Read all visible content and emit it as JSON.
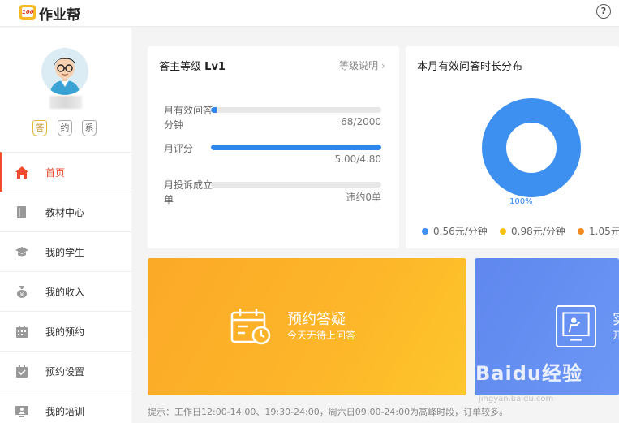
{
  "app": {
    "logo_text": "100",
    "title": "作业帮",
    "help_icon": "question-circle-icon",
    "help_label": "?"
  },
  "profile": {
    "badges": [
      "答",
      "约",
      "系"
    ]
  },
  "sidebar": {
    "items": [
      {
        "label": "首页",
        "icon": "home-icon",
        "active": true
      },
      {
        "label": "教材中心",
        "icon": "book-icon",
        "active": false
      },
      {
        "label": "我的学生",
        "icon": "graduation-cap-icon",
        "active": false
      },
      {
        "label": "我的收入",
        "icon": "money-bag-icon",
        "active": false
      },
      {
        "label": "我的预约",
        "icon": "calendar-icon",
        "active": false
      },
      {
        "label": "预约设置",
        "icon": "calendar-check-icon",
        "active": false
      },
      {
        "label": "我的培训",
        "icon": "training-icon",
        "active": false
      }
    ]
  },
  "level_card": {
    "title": "答主等级",
    "level": "Lv1",
    "link": "等级说明",
    "stats": [
      {
        "label": "月有效问答分钟",
        "value_text": "68/2000",
        "progress": 0.034
      },
      {
        "label": "月评分",
        "value_text": "5.00/4.80",
        "progress": 1.0
      },
      {
        "label": "月投诉成立单",
        "value_text": "违约0单",
        "progress": 0
      }
    ]
  },
  "distribution_card": {
    "title": "本月有效问答时长分布",
    "donut_percent": "100%",
    "donut_color": "#3d8ff0",
    "legend": [
      {
        "label": "0.56元/分钟",
        "color": "#3d8ff0"
      },
      {
        "label": "0.98元/分钟",
        "color": "#f7c30d"
      },
      {
        "label": "1.05元",
        "color": "#f48a1f"
      }
    ]
  },
  "banners": {
    "appointment": {
      "title": "预约答疑",
      "subtitle": "今天无待上问答",
      "icon": "calendar-clock-icon"
    },
    "second": {
      "title": "实",
      "subtitle": "开",
      "icon": "teacher-board-icon"
    }
  },
  "watermark": {
    "text": "Baidu经验",
    "sub": "jingyan.baidu.com"
  },
  "tip": "提示：工作日12:00-14:00、19:30-24:00，周六日09:00-24:00为高峰时段，订单较多。"
}
